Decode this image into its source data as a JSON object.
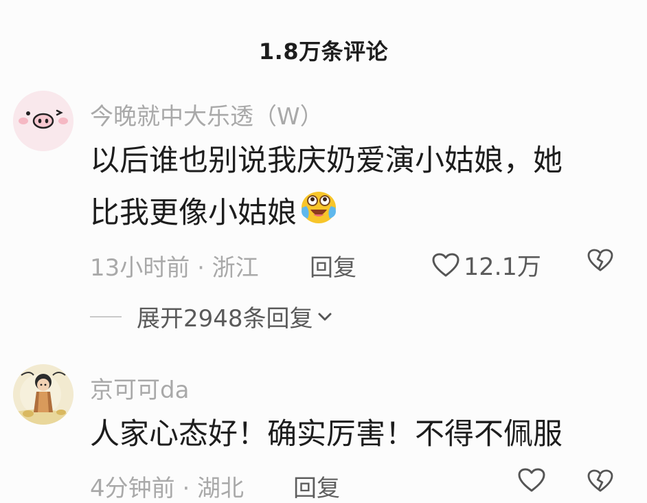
{
  "header": {
    "title": "1.8万条评论"
  },
  "comments": [
    {
      "username": "今晚就中大乐透（W）",
      "text_line1": "以后谁也别说我庆奶爱演小姑娘，她",
      "text_line2": "比我更像小姑娘",
      "time_location": "13小时前 · 浙江",
      "reply_label": "回复",
      "like_count": "12.1万",
      "expand_label": "展开2948条回复"
    },
    {
      "username": "京可可da",
      "text": "人家心态好！确实厉害！不得不佩服",
      "time_location": "4分钟前 · 湖北",
      "reply_label": "回复"
    }
  ],
  "icons": {
    "like": "heart-outline-icon",
    "dislike": "broken-heart-icon",
    "expand": "chevron-down-icon",
    "emoji": "laugh-cry-emoji-icon"
  }
}
